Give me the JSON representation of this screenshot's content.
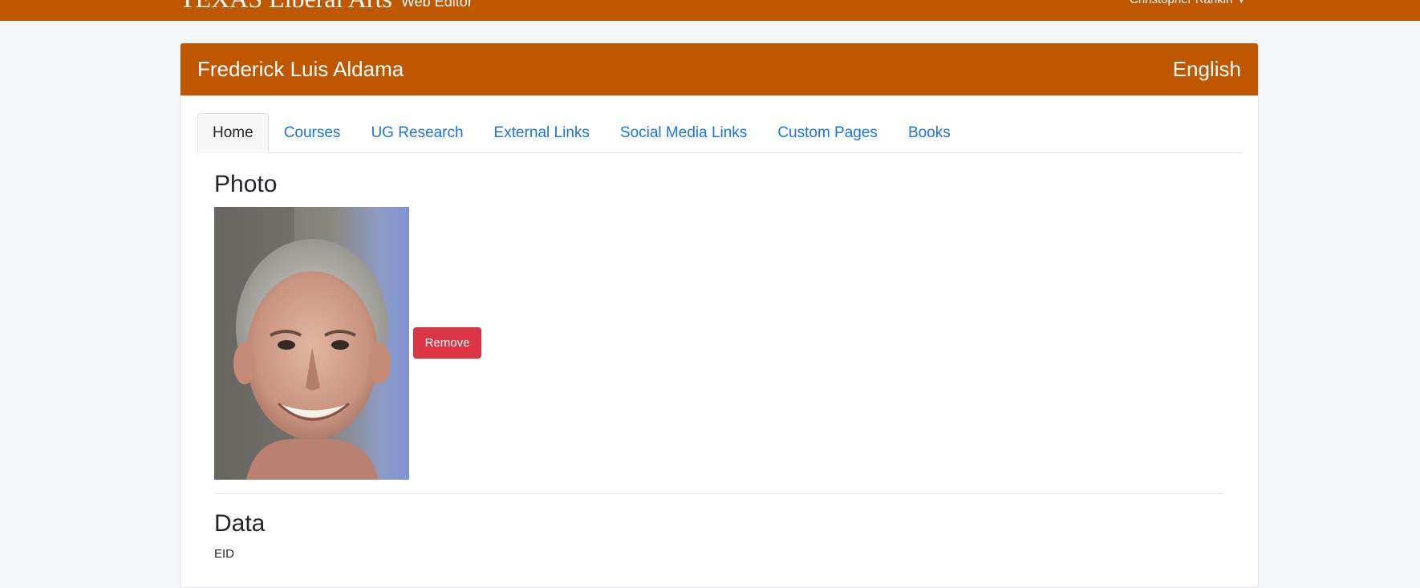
{
  "navbar": {
    "brand": "TEXAS Liberal Arts",
    "subtitle": "Web Editor",
    "user": "Christopher Rankin",
    "brand_color": "#bf5700"
  },
  "profile": {
    "name": "Frederick Luis Aldama",
    "department": "English"
  },
  "tabs": [
    {
      "label": "Home",
      "active": true
    },
    {
      "label": "Courses",
      "active": false
    },
    {
      "label": "UG Research",
      "active": false
    },
    {
      "label": "External Links",
      "active": false
    },
    {
      "label": "Social Media Links",
      "active": false
    },
    {
      "label": "Custom Pages",
      "active": false
    },
    {
      "label": "Books",
      "active": false
    }
  ],
  "photo_section": {
    "title": "Photo",
    "remove_label": "Remove"
  },
  "data_section": {
    "title": "Data",
    "eid_label": "EID"
  },
  "colors": {
    "accent": "#bf5700",
    "link": "#1a73e8",
    "danger": "#dc3545"
  }
}
